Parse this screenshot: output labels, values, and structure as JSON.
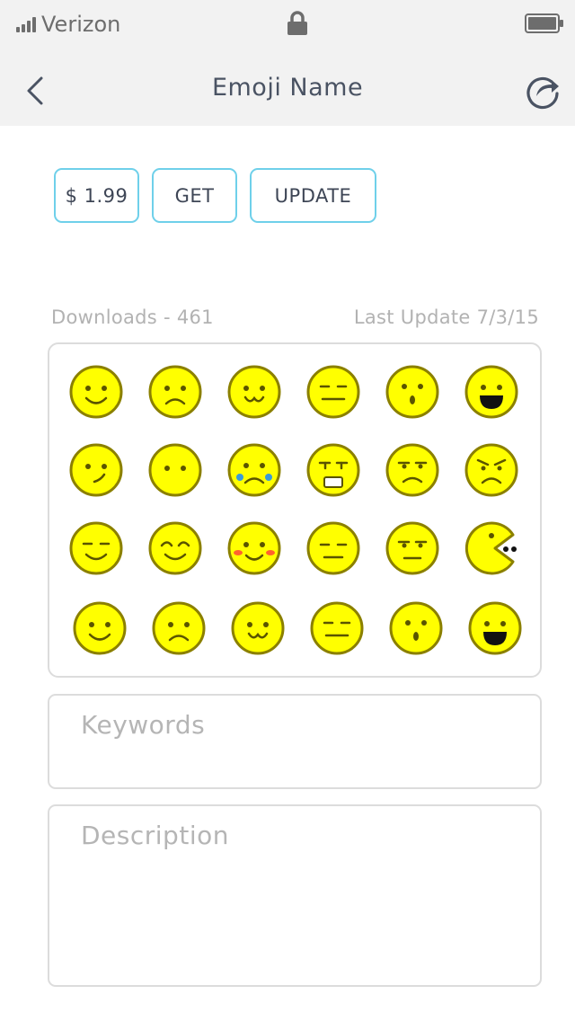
{
  "status_bar": {
    "carrier": "Verizon",
    "icons": [
      "signal-icon",
      "lock-icon",
      "battery-icon"
    ]
  },
  "nav": {
    "title": "Emoji Name",
    "back_icon": "chevron-left-icon",
    "share_icon": "share-icon"
  },
  "actions": {
    "price_label": "$ 1.99",
    "get_label": "GET",
    "update_label": "UPDATE"
  },
  "stats": {
    "downloads": "Downloads - 461",
    "last_update": "Last Update 7/3/15"
  },
  "emoji_grid": {
    "rows": [
      [
        "smile",
        "frown",
        "cat-smile",
        "neutral",
        "surprised",
        "grin"
      ],
      [
        "smirk",
        "blank",
        "crying",
        "tearful",
        "annoyed",
        "angry"
      ],
      [
        "squint-smile",
        "happy-closed-eyes",
        "blush",
        "expressionless",
        "unamused",
        "pacman"
      ],
      [
        "smile",
        "frown",
        "cat-smile",
        "neutral",
        "surprised",
        "grin"
      ]
    ],
    "colors": {
      "fill": "#ffff00",
      "stroke": "#8b8000",
      "feature": "#5a5400"
    }
  },
  "fields": {
    "keywords_placeholder": "Keywords",
    "description_placeholder": "Description"
  },
  "colors": {
    "accent": "#6fd0ea",
    "bar_bg": "#f2f2f2"
  }
}
